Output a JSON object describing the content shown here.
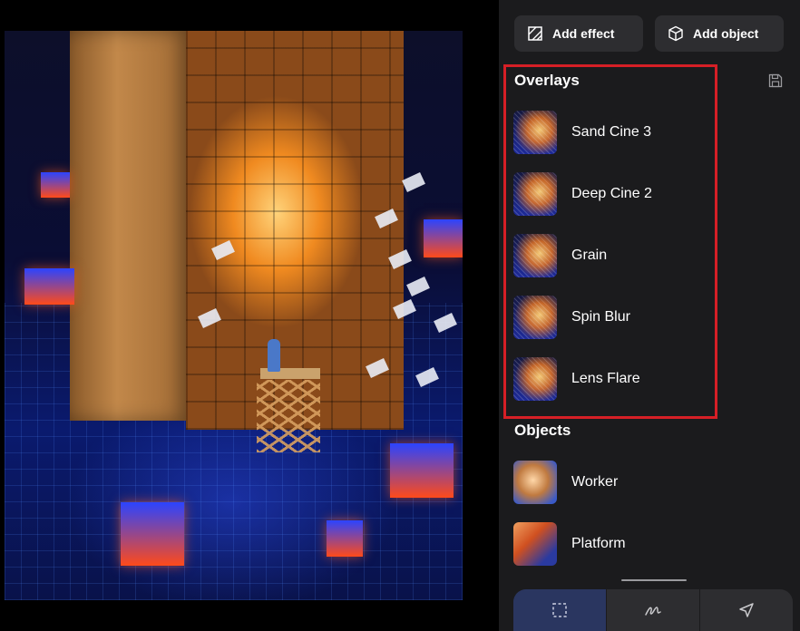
{
  "toolbar": {
    "add_effect_label": "Add effect",
    "add_effect_icon": "effect-icon",
    "add_object_label": "Add object",
    "add_object_icon": "cube-icon"
  },
  "overlays": {
    "title": "Overlays",
    "save_icon": "save-icon",
    "items": [
      {
        "label": "Sand Cine 3"
      },
      {
        "label": "Deep Cine 2"
      },
      {
        "label": "Grain"
      },
      {
        "label": "Spin Blur"
      },
      {
        "label": "Lens Flare"
      }
    ]
  },
  "objects": {
    "title": "Objects",
    "items": [
      {
        "label": "Worker"
      },
      {
        "label": "Platform"
      }
    ]
  },
  "bottom_tools": [
    {
      "name": "selection-icon",
      "active": true
    },
    {
      "name": "draw-icon",
      "active": false
    },
    {
      "name": "pointer-icon",
      "active": false
    }
  ],
  "colors": {
    "panel_bg": "#1b1b1d",
    "button_bg": "#2d2d30",
    "highlight": "#d61f26",
    "active_tool": "#2a3660"
  }
}
